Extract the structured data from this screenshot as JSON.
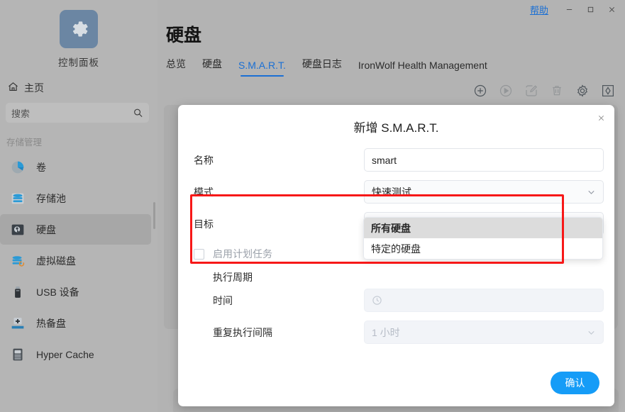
{
  "sidebar": {
    "brand_label": "控制面板",
    "home_label": "主页",
    "search_placeholder": "搜索",
    "group_title": "存储管理",
    "items": [
      {
        "label": "卷",
        "icon": "volume-icon"
      },
      {
        "label": "存储池",
        "icon": "storage-pool-icon"
      },
      {
        "label": "硬盘",
        "icon": "hard-disk-icon"
      },
      {
        "label": "虚拟磁盘",
        "icon": "virtual-disk-icon"
      },
      {
        "label": "USB 设备",
        "icon": "usb-device-icon"
      },
      {
        "label": "热备盘",
        "icon": "hot-spare-icon"
      },
      {
        "label": "Hyper Cache",
        "icon": "hyper-cache-icon"
      }
    ]
  },
  "titlebar": {
    "help_label": "帮助",
    "minimize_label": "−",
    "maximize_label": "□",
    "close_label": "×"
  },
  "header": {
    "page_title": "硬盘",
    "tabs": [
      {
        "label": "总览"
      },
      {
        "label": "硬盘"
      },
      {
        "label": "S.M.A.R.T."
      },
      {
        "label": "硬盘日志"
      },
      {
        "label": "IronWolf Health Management"
      }
    ],
    "active_tab_index": 2
  },
  "toolbar": {
    "buttons": [
      {
        "icon": "add-icon",
        "enabled": true
      },
      {
        "icon": "play-icon",
        "enabled": false
      },
      {
        "icon": "edit-icon",
        "enabled": false
      },
      {
        "icon": "delete-icon",
        "enabled": false
      },
      {
        "icon": "gear-icon",
        "enabled": true
      },
      {
        "icon": "diagnose-icon",
        "enabled": true
      }
    ]
  },
  "dialog": {
    "title": "新增 S.M.A.R.T.",
    "close_label": "×",
    "fields": {
      "name_label": "名称",
      "name_value": "smart",
      "mode_label": "模式",
      "mode_value": "快速测试",
      "target_label": "目标",
      "target_value": "所有硬盘",
      "schedule_checkbox_label": "启用计划任务",
      "period_label": "执行周期",
      "time_label": "时间",
      "time_value": "",
      "repeat_label": "重复执行间隔",
      "repeat_value": "1 小时"
    },
    "target_dropdown": {
      "options": [
        {
          "label": "所有硬盘",
          "selected": true
        },
        {
          "label": "特定的硬盘",
          "selected": false
        }
      ]
    },
    "confirm_label": "确认"
  },
  "colors": {
    "accent_blue": "#1a6fd4",
    "button_blue": "#159cf7",
    "annotation_red": "#f71818",
    "sidebar_bg": "#b5b5b5"
  }
}
